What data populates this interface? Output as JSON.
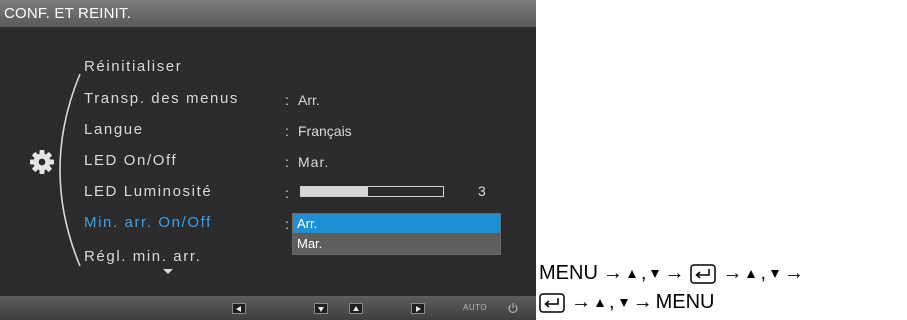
{
  "osd": {
    "title": "CONF. ET REINIT.",
    "menu": [
      {
        "label": "Réinitialiser",
        "value": ""
      },
      {
        "label": "Transp. des menus",
        "value": "Arr."
      },
      {
        "label": "Langue",
        "value": "Français"
      },
      {
        "label": "LED On/Off",
        "value": "Mar."
      },
      {
        "label": "LED Luminosité",
        "value": "3"
      },
      {
        "label": "Min. arr. On/Off",
        "value": ""
      },
      {
        "label": "Régl. min. arr.",
        "value": ""
      }
    ],
    "colon": ":",
    "led_brightness_level": 0.47,
    "dropdown": {
      "selected": "Arr.",
      "other": "Mar."
    },
    "active_color": "#3f9fe4",
    "selection_color": "#1c8fd6",
    "auto_label": "AUTO",
    "icons": {
      "settings": "gear-icon",
      "power": "power-icon",
      "keys": [
        "left-key-icon",
        "down-key-icon",
        "up-key-icon",
        "right-key-icon"
      ]
    }
  },
  "instructions": {
    "menu": "MENU",
    "arrow": "→",
    "comma": ","
  }
}
